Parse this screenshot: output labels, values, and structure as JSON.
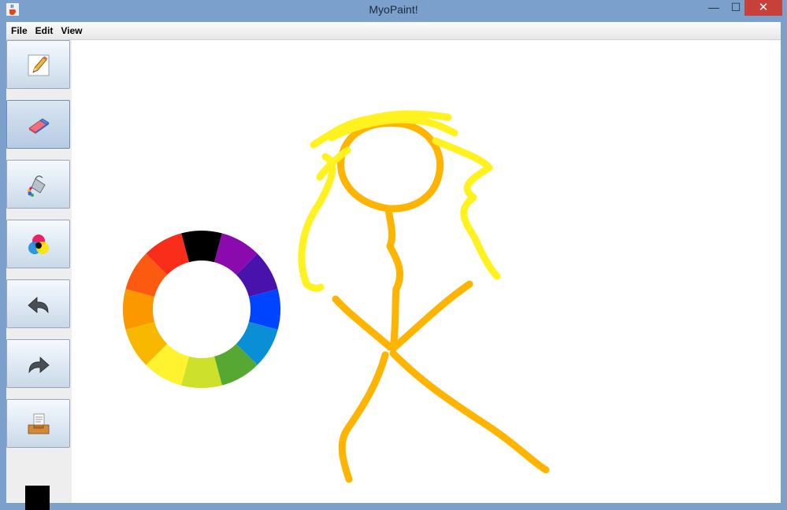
{
  "window": {
    "title": "MyoPaint!",
    "app_icon": "java-coffee-cup-icon",
    "controls": {
      "minimize": "—",
      "maximize": "☐",
      "close": "✕"
    }
  },
  "menu": {
    "items": [
      "File",
      "Edit",
      "View"
    ]
  },
  "toolbar": {
    "tools": [
      {
        "name": "pencil",
        "icon": "pencil-icon"
      },
      {
        "name": "eraser",
        "icon": "eraser-icon",
        "active": true
      },
      {
        "name": "fill",
        "icon": "paint-bucket-icon"
      },
      {
        "name": "color",
        "icon": "color-circles-icon"
      },
      {
        "name": "undo",
        "icon": "undo-arrow-icon"
      },
      {
        "name": "redo",
        "icon": "redo-arrow-icon"
      },
      {
        "name": "save",
        "icon": "document-tray-icon"
      }
    ],
    "current_color": "#000000"
  },
  "color_wheel": {
    "segments": [
      "#000000",
      "#8a0aad",
      "#4a12ad",
      "#0044ff",
      "#0a8ed6",
      "#57a832",
      "#cde12a",
      "#fff22f",
      "#f9b800",
      "#fb9800",
      "#fb5a10",
      "#fa2c1a"
    ]
  },
  "drawing": {
    "colors": {
      "figure": "#ffb400",
      "hair": "#fff21f"
    }
  }
}
